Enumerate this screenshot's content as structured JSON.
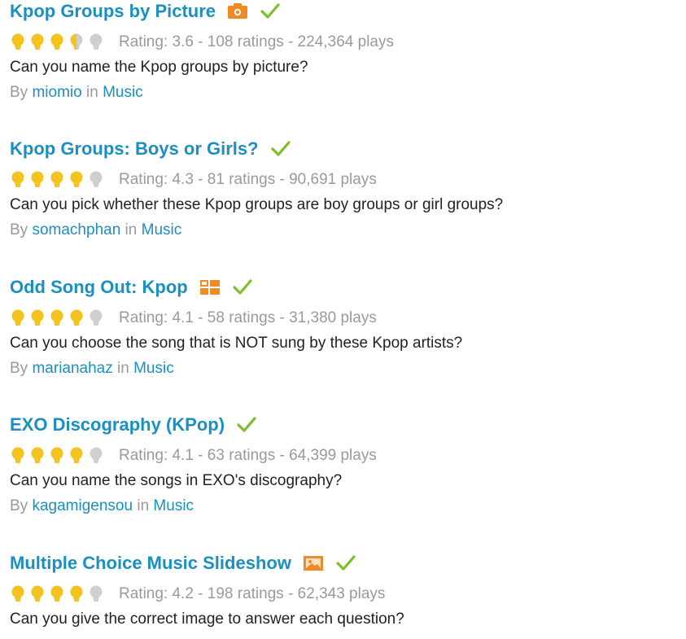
{
  "byline": {
    "by": "By",
    "in": "in"
  },
  "colors": {
    "title_link": "#1a8fc1",
    "meta_text": "#9a9a9a",
    "body_text": "#222222",
    "star_full": "#f5c31d",
    "star_empty": "#cfcfcf",
    "check": "#7cbf2a",
    "icon_orange": "#f08a24"
  },
  "quizzes": [
    {
      "title": "Kpop Groups by Picture",
      "type_icon": "picture-quiz-icon",
      "rating_value": 3.6,
      "rating_text": "Rating: 3.6 - 108 ratings - 224,364 plays",
      "description": "Can you name the Kpop groups by picture?",
      "author": "miomio",
      "category": "Music"
    },
    {
      "title": "Kpop Groups: Boys or Girls?",
      "type_icon": "",
      "rating_value": 4.3,
      "rating_text": "Rating: 4.3 - 81 ratings - 90,691 plays",
      "description": "Can you pick whether these Kpop groups are boy groups or girl groups?",
      "author": "somachphan",
      "category": "Music"
    },
    {
      "title": "Odd Song Out: Kpop",
      "type_icon": "grid-quiz-icon",
      "rating_value": 4.1,
      "rating_text": "Rating: 4.1 - 58 ratings - 31,380 plays",
      "description": "Can you choose the song that is NOT sung by these Kpop artists?",
      "author": "marianahaz",
      "category": "Music"
    },
    {
      "title": "EXO Discography (KPop)",
      "type_icon": "",
      "rating_value": 4.1,
      "rating_text": "Rating: 4.1 - 63 ratings - 64,399 plays",
      "description": "Can you name the songs in EXO's discography?",
      "author": "kagamigensou",
      "category": "Music"
    },
    {
      "title": "Multiple Choice Music Slideshow",
      "type_icon": "slideshow-quiz-icon",
      "rating_value": 4.2,
      "rating_text": "Rating: 4.2 - 198 ratings - 62,343 plays",
      "description": "Can you give the correct image to answer each question?",
      "author": "",
      "category": ""
    }
  ]
}
